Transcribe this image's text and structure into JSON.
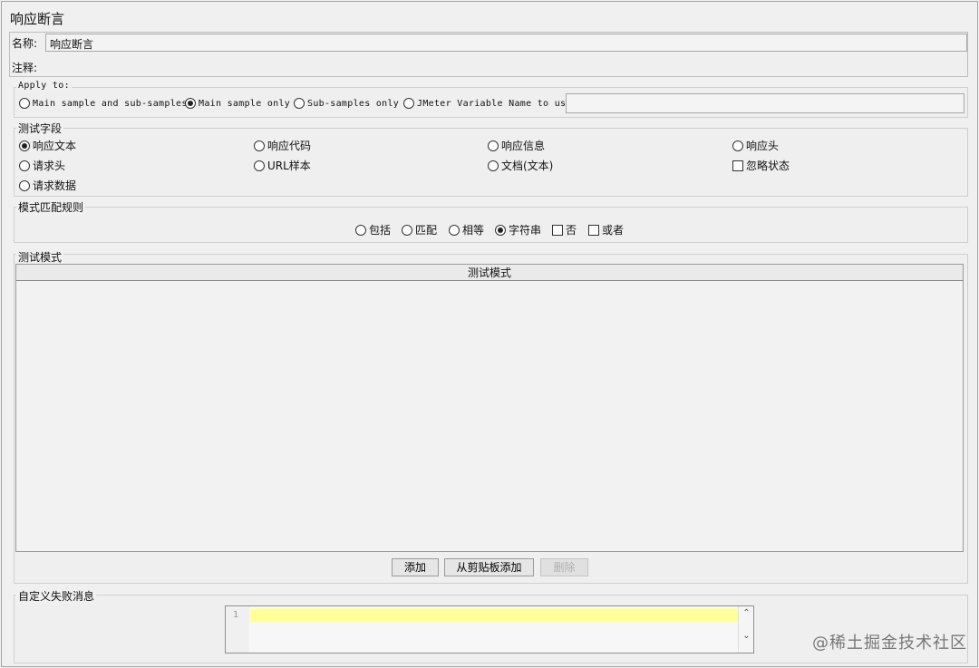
{
  "panel": {
    "title": "响应断言"
  },
  "name_field": {
    "label": "名称:",
    "value": "响应断言"
  },
  "comment_field": {
    "label": "注释:"
  },
  "apply_to": {
    "title": "Apply to:",
    "options": [
      {
        "label": "Main sample and sub-samples",
        "selected": false
      },
      {
        "label": "Main sample only",
        "selected": true
      },
      {
        "label": "Sub-samples only",
        "selected": false
      },
      {
        "label": "JMeter Variable Name to use",
        "selected": false
      }
    ],
    "variable_value": ""
  },
  "test_field": {
    "title": "测试字段",
    "options": [
      {
        "label": "响应文本",
        "selected": true
      },
      {
        "label": "响应代码",
        "selected": false
      },
      {
        "label": "响应信息",
        "selected": false
      },
      {
        "label": "响应头",
        "selected": false
      },
      {
        "label": "请求头",
        "selected": false
      },
      {
        "label": "URL样本",
        "selected": false
      },
      {
        "label": "文档(文本)",
        "selected": false
      },
      {
        "label": "请求数据",
        "selected": false
      }
    ],
    "ignore_status": {
      "label": "忽略状态",
      "checked": false
    }
  },
  "pattern_rules": {
    "title": "模式匹配规则",
    "options": [
      {
        "label": "包括",
        "selected": false
      },
      {
        "label": "匹配",
        "selected": false
      },
      {
        "label": "相等",
        "selected": false
      },
      {
        "label": "字符串",
        "selected": true
      }
    ],
    "not": {
      "label": "否",
      "checked": false
    },
    "or": {
      "label": "或者",
      "checked": false
    }
  },
  "test_patterns": {
    "title": "测试模式",
    "column_header": "测试模式",
    "rows": []
  },
  "buttons": {
    "add": "添加",
    "add_clipboard": "从剪贴板添加",
    "delete": "删除"
  },
  "failure_message": {
    "title": "自定义失败消息",
    "line_number": "1",
    "text": "",
    "scroll_up": "⌃",
    "scroll_down": "⌄"
  },
  "watermark": "@稀土掘金技术社区"
}
